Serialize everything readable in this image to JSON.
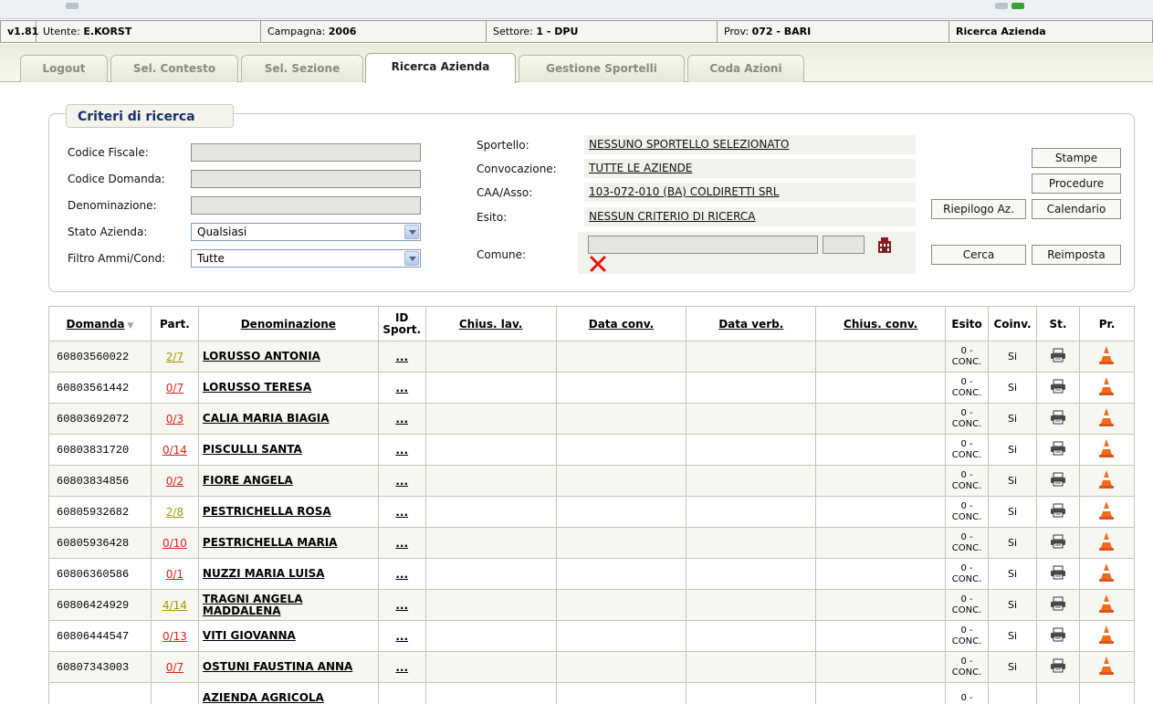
{
  "status": {
    "version": "v1.81",
    "user_label": "Utente:",
    "user_value": "E.KORST",
    "campaign_label": "Campagna:",
    "campaign_value": "2006",
    "sector_label": "Settore:",
    "sector_value": "1 - DPU",
    "prov_label": "Prov:",
    "prov_value": "072 - BARI",
    "page": "Ricerca Azienda"
  },
  "tabs": [
    {
      "label": "Logout"
    },
    {
      "label": "Sel. Contesto"
    },
    {
      "label": "Sel. Sezione"
    },
    {
      "label": "Ricerca Azienda",
      "active": true
    },
    {
      "label": "Gestione Sportelli"
    },
    {
      "label": "Coda Azioni"
    }
  ],
  "criteria": {
    "legend": "Criteri di ricerca",
    "codice_fiscale_label": "Codice Fiscale:",
    "codice_fiscale_value": "",
    "codice_domanda_label": "Codice Domanda:",
    "codice_domanda_value": "",
    "denominazione_label": "Denominazione:",
    "denominazione_value": "",
    "stato_azienda_label": "Stato Azienda:",
    "stato_azienda_value": "Qualsiasi",
    "filtro_label": "Filtro Ammi/Cond:",
    "filtro_value": "Tutte",
    "sportello_label": "Sportello:",
    "sportello_value": "NESSUNO SPORTELLO SELEZIONATO",
    "convocazione_label": "Convocazione:",
    "convocazione_value": "TUTTE LE AZIENDE",
    "caa_label": "CAA/Asso:",
    "caa_value": "103-072-010 (BA) COLDIRETTI SRL",
    "esito_label": "Esito:",
    "esito_value": "NESSUN CRITERIO DI RICERCA",
    "comune_label": "Comune:",
    "comune_value": "",
    "comune_code_value": ""
  },
  "buttons": {
    "stampe": "Stampe",
    "procedure": "Procedure",
    "riepilogo": "Riepilogo Az.",
    "calendario": "Calendario",
    "cerca": "Cerca",
    "reimposta": "Reimposta"
  },
  "table": {
    "headers": {
      "domanda": "Domanda",
      "part": "Part.",
      "denominazione": "Denominazione",
      "id_sport": "ID Sport.",
      "chius_lav": "Chius. lav.",
      "data_conv": "Data conv.",
      "data_verb": "Data verb.",
      "chius_conv": "Chius. conv.",
      "esito": "Esito",
      "coinv": "Coinv.",
      "st": "St.",
      "pr": "Pr."
    },
    "rows": [
      {
        "domanda": "60803560022",
        "part": "2/7",
        "part_color": "olive",
        "den": "LORUSSO ANTONIA",
        "idsport": "...",
        "esito": "0 - CONC.",
        "coinv": "Si"
      },
      {
        "domanda": "60803561442",
        "part": "0/7",
        "part_color": "red",
        "den": "LORUSSO TERESA",
        "idsport": "...",
        "esito": "0 - CONC.",
        "coinv": "Si"
      },
      {
        "domanda": "60803692072",
        "part": "0/3",
        "part_color": "red",
        "den": "CALIA MARIA BIAGIA",
        "idsport": "...",
        "esito": "0 - CONC.",
        "coinv": "Si"
      },
      {
        "domanda": "60803831720",
        "part": "0/14",
        "part_color": "red",
        "den": "PISCULLI SANTA",
        "idsport": "...",
        "esito": "0 - CONC.",
        "coinv": "Si"
      },
      {
        "domanda": "60803834856",
        "part": "0/2",
        "part_color": "red",
        "den": "FIORE ANGELA",
        "idsport": "...",
        "esito": "0 - CONC.",
        "coinv": "Si"
      },
      {
        "domanda": "60805932682",
        "part": "2/8",
        "part_color": "olive",
        "den": "PESTRICHELLA ROSA",
        "idsport": "...",
        "esito": "0 - CONC.",
        "coinv": "Si"
      },
      {
        "domanda": "60805936428",
        "part": "0/10",
        "part_color": "red",
        "den": "PESTRICHELLA MARIA",
        "idsport": "...",
        "esito": "0 - CONC.",
        "coinv": "Si"
      },
      {
        "domanda": "60806360586",
        "part": "0/1",
        "part_color": "red",
        "den": "NUZZI MARIA LUISA",
        "idsport": "...",
        "esito": "0 - CONC.",
        "coinv": "Si"
      },
      {
        "domanda": "60806424929",
        "part": "4/14",
        "part_color": "olive",
        "den": "TRAGNI ANGELA MADDALENA",
        "idsport": "...",
        "esito": "0 - CONC.",
        "coinv": "Si"
      },
      {
        "domanda": "60806444547",
        "part": "0/13",
        "part_color": "red",
        "den": "VITI GIOVANNA",
        "idsport": "...",
        "esito": "0 - CONC.",
        "coinv": "Si"
      },
      {
        "domanda": "60807343003",
        "part": "0/7",
        "part_color": "red",
        "den": "OSTUNI FAUSTINA ANNA",
        "idsport": "...",
        "esito": "0 - CONC.",
        "coinv": "Si"
      },
      {
        "domanda": "",
        "part": "",
        "part_color": "red",
        "den": "AZIENDA AGRICOLA",
        "idsport": "",
        "esito": "0 -",
        "coinv": ""
      }
    ]
  },
  "icons": {
    "print": "printer-icon",
    "procedure": "traffic-cone-icon",
    "sort": "sort-desc-icon",
    "comune_lookup": "building-icon",
    "clear": "clear-x-icon"
  },
  "colors": {
    "link_red": "#e31e1e",
    "link_olive": "#a39a00",
    "legend_text": "#16306e",
    "clear_red": "#e01515",
    "cone_orange": "#f26a1b"
  }
}
